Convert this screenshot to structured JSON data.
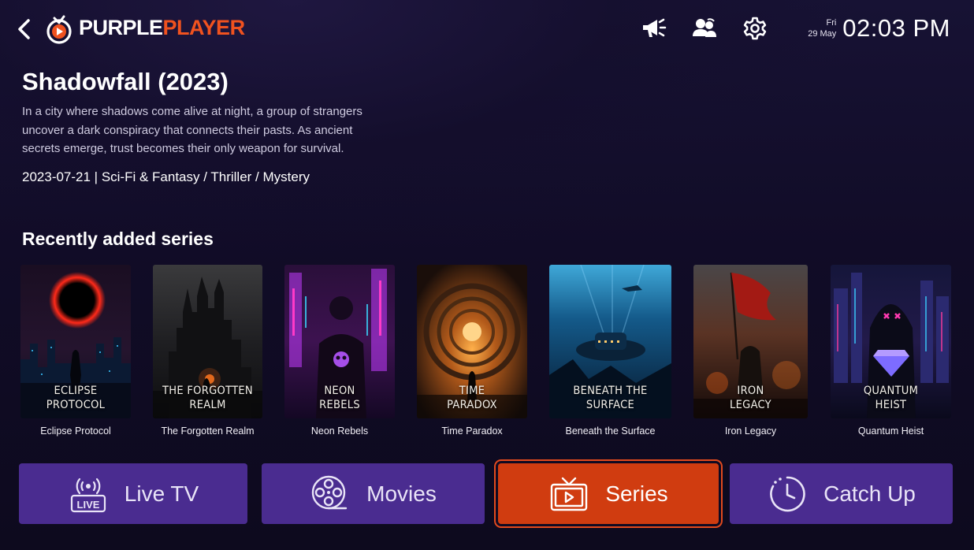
{
  "app": {
    "logo_word_1": "PURPLE",
    "logo_word_2": "PLAYER",
    "accent_color": "#f0521f",
    "nav_color": "#4a2c90",
    "active_color": "#d03c10"
  },
  "header": {
    "icons": [
      "megaphone-icon",
      "users-icon",
      "settings-gear-icon"
    ],
    "day": "Fri",
    "date": "29 May",
    "time": "02:03 PM"
  },
  "details": {
    "title": "Shadowfall (2023)",
    "description": "In a city where shadows come alive at night, a group of strangers uncover a dark conspiracy that connects their pasts. As ancient secrets emerge, trust becomes their only weapon for survival.",
    "meta": "2023-07-21 | Sci-Fi & Fantasy / Thriller / Mystery"
  },
  "recent": {
    "heading": "Recently added series",
    "items": [
      {
        "poster_line1": "ECLIPSE",
        "poster_line2": "PROTOCOL",
        "caption": "Eclipse Protocol"
      },
      {
        "poster_line1": "THE FORGOTTEN",
        "poster_line2": "REALM",
        "caption": "The Forgotten Realm"
      },
      {
        "poster_line1": "NEON",
        "poster_line2": "REBELS",
        "caption": "Neon Rebels"
      },
      {
        "poster_line1": "TIME",
        "poster_line2": "PARADOX",
        "caption": "Time Paradox"
      },
      {
        "poster_line1": "BENEATH THE",
        "poster_line2": "SURFACE",
        "caption": "Beneath the Surface"
      },
      {
        "poster_line1": "IRON",
        "poster_line2": "LEGACY",
        "caption": "Iron Legacy"
      },
      {
        "poster_line1": "QUANTUM",
        "poster_line2": "HEIST",
        "caption": "Quantum Heist"
      }
    ]
  },
  "nav": [
    {
      "label": "Live TV",
      "icon": "live-tv-icon",
      "icon_text": "LIVE",
      "active": false
    },
    {
      "label": "Movies",
      "icon": "film-reel-icon",
      "active": false
    },
    {
      "label": "Series",
      "icon": "tv-play-icon",
      "active": true
    },
    {
      "label": "Catch Up",
      "icon": "clock-rewind-icon",
      "active": false
    }
  ]
}
